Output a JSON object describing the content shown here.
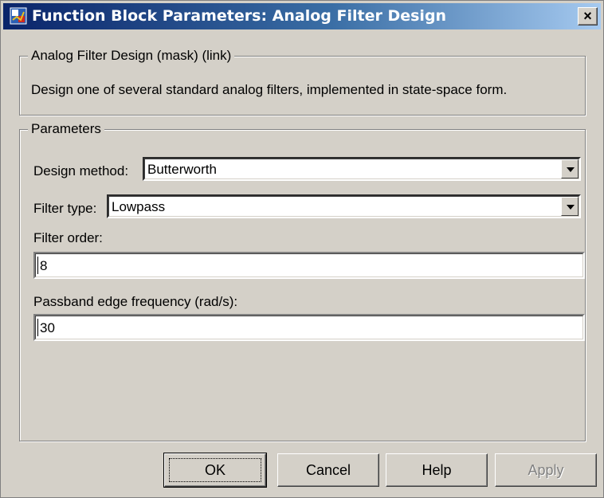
{
  "window": {
    "title": "Function Block Parameters: Analog Filter Design",
    "close_label": "×"
  },
  "mask": {
    "legend": "Analog Filter Design (mask) (link)",
    "description": "Design one of several standard analog filters, implemented in state-space form."
  },
  "parameters": {
    "legend": "Parameters",
    "design_method": {
      "label": "Design method:",
      "value": "Butterworth"
    },
    "filter_type": {
      "label": "Filter type:",
      "value": "Lowpass"
    },
    "filter_order": {
      "label": "Filter order:",
      "value": "8"
    },
    "passband_edge": {
      "label": "Passband edge frequency (rad/s):",
      "value": "30"
    }
  },
  "buttons": {
    "ok": "OK",
    "cancel": "Cancel",
    "help": "Help",
    "apply": "Apply"
  },
  "colors": {
    "title_start": "#0a246a",
    "title_end": "#a6caf0",
    "dialog_bg": "#d4d0c8"
  },
  "icons": {
    "title_icon": "simulink-block-icon",
    "close_icon": "close-icon",
    "dropdown_icon": "chevron-down-icon"
  }
}
